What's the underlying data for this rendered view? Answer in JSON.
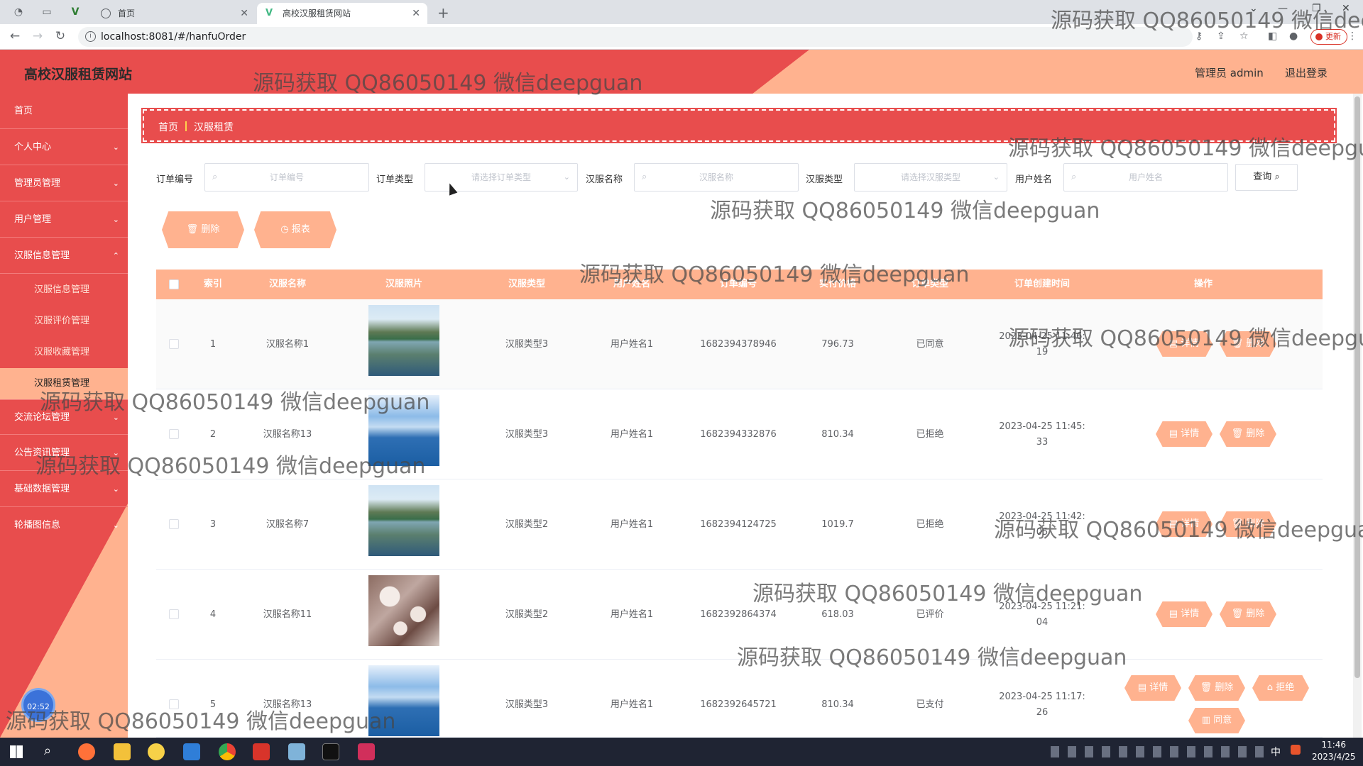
{
  "browser": {
    "tabs": [
      {
        "title": "首页"
      },
      {
        "title": "高校汉服租赁网站"
      }
    ],
    "url": "localhost:8081/#/hanfuOrder",
    "update_label": "更新"
  },
  "header": {
    "title": "高校汉服租赁网站",
    "user": "管理员 admin",
    "logout": "退出登录"
  },
  "sidebar": {
    "items": [
      {
        "label": "首页"
      },
      {
        "label": "个人中心"
      },
      {
        "label": "管理员管理"
      },
      {
        "label": "用户管理"
      },
      {
        "label": "汉服信息管理"
      },
      {
        "label": "交流论坛管理"
      },
      {
        "label": "公告资讯管理"
      },
      {
        "label": "基础数据管理"
      },
      {
        "label": "轮播图信息"
      }
    ],
    "subitems": [
      {
        "label": "汉服信息管理"
      },
      {
        "label": "汉服评价管理"
      },
      {
        "label": "汉服收藏管理"
      },
      {
        "label": "汉服租赁管理"
      }
    ],
    "clock": "02:52"
  },
  "breadcrumb": {
    "home": "首页",
    "current": "汉服租赁"
  },
  "filters": {
    "order_no_label": "订单编号",
    "order_no_placeholder": "订单编号",
    "order_type_label": "订单类型",
    "order_type_placeholder": "请选择订单类型",
    "hanfu_name_label": "汉服名称",
    "hanfu_name_placeholder": "汉服名称",
    "hanfu_type_label": "汉服类型",
    "hanfu_type_placeholder": "请选择汉服类型",
    "user_name_label": "用户姓名",
    "user_name_placeholder": "用户姓名",
    "query_label": "查询"
  },
  "actions": {
    "delete": "删除",
    "report": "报表"
  },
  "table": {
    "headers": [
      "索引",
      "汉服名称",
      "汉服照片",
      "汉服类型",
      "用户姓名",
      "订单编号",
      "实付价格",
      "订单类型",
      "订单创建时间",
      "操作"
    ],
    "rows": [
      {
        "index": "1",
        "name": "汉服名称1",
        "photo": "mountain-lake-photo",
        "type": "汉服类型3",
        "user": "用户姓名1",
        "order_no": "1682394378946",
        "price": "796.73",
        "status": "已同意",
        "time_line1": "2023-04-25 11:46:",
        "time_line2": "19",
        "ops": [
          "详情",
          "删除"
        ]
      },
      {
        "index": "2",
        "name": "汉服名称13",
        "photo": "sea-sky-photo",
        "type": "汉服类型3",
        "user": "用户姓名1",
        "order_no": "1682394332876",
        "price": "810.34",
        "status": "已拒绝",
        "time_line1": "2023-04-25 11:45:",
        "time_line2": "33",
        "ops": [
          "详情",
          "删除"
        ]
      },
      {
        "index": "3",
        "name": "汉服名称7",
        "photo": "mountain-lake-photo",
        "type": "汉服类型2",
        "user": "用户姓名1",
        "order_no": "1682394124725",
        "price": "1019.7",
        "status": "已拒绝",
        "time_line1": "2023-04-25 11:42:",
        "time_line2": "05",
        "ops": [
          "详情",
          "删除"
        ]
      },
      {
        "index": "4",
        "name": "汉服名称11",
        "photo": "blossom-photo",
        "type": "汉服类型2",
        "user": "用户姓名1",
        "order_no": "1682392864374",
        "price": "618.03",
        "status": "已评价",
        "time_line1": "2023-04-25 11:21:",
        "time_line2": "04",
        "ops": [
          "详情",
          "删除"
        ]
      },
      {
        "index": "5",
        "name": "汉服名称13",
        "photo": "sea-sky-photo",
        "type": "汉服类型3",
        "user": "用户姓名1",
        "order_no": "1682392645721",
        "price": "810.34",
        "status": "已支付",
        "time_line1": "2023-04-25 11:17:",
        "time_line2": "26",
        "ops": [
          "详情",
          "删除",
          "拒绝",
          "同意"
        ]
      }
    ]
  },
  "watermark": "源码获取 QQ86050149 微信deepguan",
  "taskbar": {
    "time": "11:46",
    "date": "2023/4/25",
    "ime": "中"
  },
  "colors": {
    "primary_red": "#e84d4d",
    "accent_peach": "#ffb28f"
  }
}
